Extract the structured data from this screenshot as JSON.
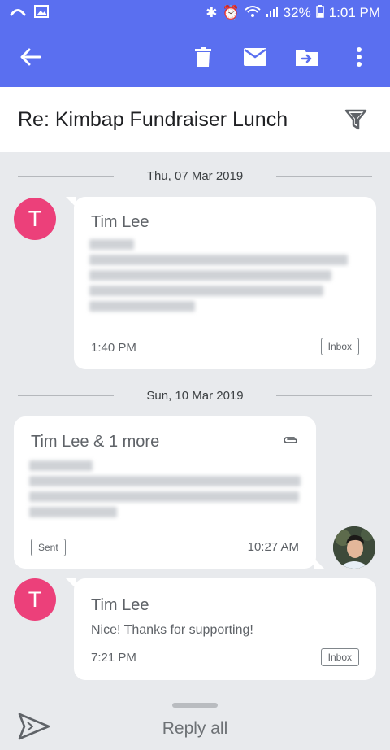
{
  "status_bar": {
    "battery": "32%",
    "time": "1:01 PM"
  },
  "toolbar": {
    "icons": [
      "back-arrow-icon",
      "trash-icon",
      "mail-icon",
      "move-to-folder-icon",
      "more-vert-icon"
    ]
  },
  "thread": {
    "subject": "Re: Kimbap Fundraiser Lunch"
  },
  "groups": [
    {
      "date": "Thu, 07 Mar 2019"
    },
    {
      "date": "Sun, 10 Mar 2019"
    }
  ],
  "messages": [
    {
      "avatar_initial": "T",
      "avatar_color": "#ec407a",
      "sender": "Tim Lee",
      "time": "1:40 PM",
      "label": "Inbox",
      "snippet_blurred": true
    },
    {
      "sender": "Tim Lee & 1 more",
      "time": "10:27 AM",
      "label": "Sent",
      "has_attachment": true,
      "snippet_blurred": true
    },
    {
      "avatar_initial": "T",
      "avatar_color": "#ec407a",
      "sender": "Tim Lee",
      "snippet": "Nice! Thanks for supporting!",
      "time": "7:21 PM",
      "label": "Inbox"
    }
  ],
  "bottom": {
    "reply_all_label": "Reply all"
  },
  "colors": {
    "app_bar": "#5a6ff0",
    "background": "#e8eaed",
    "avatar": "#ec407a"
  }
}
